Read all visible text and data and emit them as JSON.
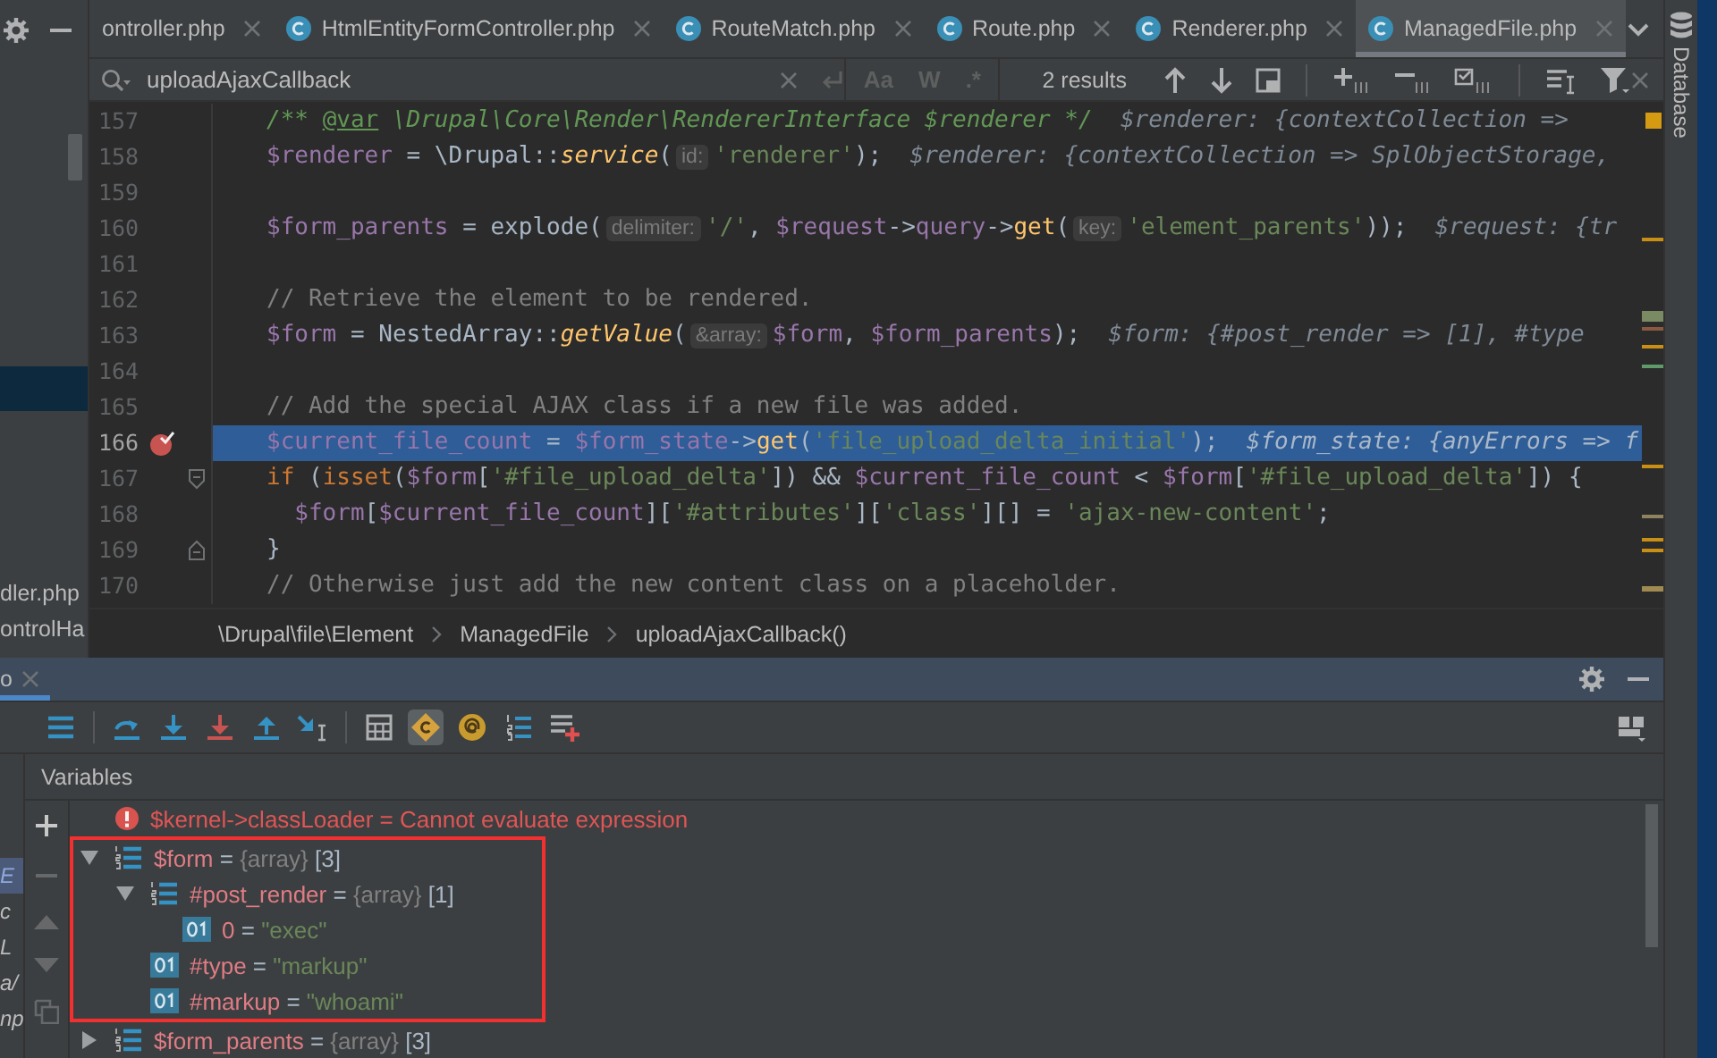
{
  "project_panel": {
    "items": [
      {
        "selected": true
      },
      {
        "label": "dler.php",
        "selected": false
      },
      {
        "label": "ontrolHa",
        "selected": false
      }
    ]
  },
  "tabs": [
    {
      "label": "ontroller.php",
      "icon": false,
      "selected": false
    },
    {
      "label": "HtmlEntityFormController.php",
      "icon": true,
      "selected": false
    },
    {
      "label": "RouteMatch.php",
      "icon": true,
      "selected": false
    },
    {
      "label": "Route.php",
      "icon": true,
      "selected": false
    },
    {
      "label": "Renderer.php",
      "icon": true,
      "selected": false
    },
    {
      "label": "ManagedFile.php",
      "icon": true,
      "selected": true
    }
  ],
  "search": {
    "value": "uploadAjaxCallback",
    "options": [
      {
        "label": "Aa",
        "on": false
      },
      {
        "label": "W",
        "on": false
      },
      {
        "label": ".*",
        "on": false
      }
    ],
    "results": "2 results"
  },
  "code_lines": [
    {
      "number": "157",
      "tokens": [
        {
          "kind": "doc",
          "text": "/** "
        },
        {
          "kind": "doctag",
          "text": "@var"
        },
        {
          "kind": "doc",
          "text": " \\Drupal\\Core\\Render\\RendererInterface $renderer */  "
        },
        {
          "kind": "val",
          "text": "$renderer: {contextCollection =>"
        }
      ]
    },
    {
      "number": "158",
      "tokens": [
        {
          "kind": "var",
          "text": "$renderer"
        },
        {
          "kind": "pl",
          "text": " = \\Drupal::"
        },
        {
          "kind": "fn",
          "text": "service"
        },
        {
          "kind": "pl",
          "text": "("
        },
        {
          "kind": "hint",
          "text": "id:"
        },
        {
          "kind": "str",
          "text": "'renderer'"
        },
        {
          "kind": "pl",
          "text": ");  "
        },
        {
          "kind": "val",
          "text": "$renderer: {contextCollection => SplObjectStorage,"
        }
      ]
    },
    {
      "number": "159"
    },
    {
      "number": "160",
      "tokens": [
        {
          "kind": "var",
          "text": "$form_parents"
        },
        {
          "kind": "pl",
          "text": " = explode("
        },
        {
          "kind": "hint",
          "text": "delimiter:"
        },
        {
          "kind": "str",
          "text": "'/'"
        },
        {
          "kind": "pl",
          "text": ", "
        },
        {
          "kind": "var",
          "text": "$request"
        },
        {
          "kind": "pl",
          "text": "->"
        },
        {
          "kind": "var",
          "text": "query"
        },
        {
          "kind": "pl",
          "text": "->"
        },
        {
          "kind": "call",
          "text": "get"
        },
        {
          "kind": "pl",
          "text": "("
        },
        {
          "kind": "hint",
          "text": "key:"
        },
        {
          "kind": "str",
          "text": "'element_parents'"
        },
        {
          "kind": "pl",
          "text": "));  "
        },
        {
          "kind": "val",
          "text": "$request: {tr"
        }
      ]
    },
    {
      "number": "161"
    },
    {
      "number": "162",
      "tokens": [
        {
          "kind": "cm",
          "text": "// Retrieve the element to be rendered."
        }
      ]
    },
    {
      "number": "163",
      "tokens": [
        {
          "kind": "var",
          "text": "$form"
        },
        {
          "kind": "pl",
          "text": " = NestedArray::"
        },
        {
          "kind": "fn",
          "text": "getValue"
        },
        {
          "kind": "pl",
          "text": "("
        },
        {
          "kind": "hint",
          "text": "&array:"
        },
        {
          "kind": "var",
          "text": "$form"
        },
        {
          "kind": "pl",
          "text": ", "
        },
        {
          "kind": "var",
          "text": "$form_parents"
        },
        {
          "kind": "pl",
          "text": ");  "
        },
        {
          "kind": "val",
          "text": "$form: {#post_render => [1], #type"
        }
      ]
    },
    {
      "number": "164"
    },
    {
      "number": "165",
      "tokens": [
        {
          "kind": "cm",
          "text": "// Add the special AJAX class if a new file was added."
        }
      ]
    },
    {
      "number": "166",
      "breakpoint": true,
      "current": true,
      "tokens": [
        {
          "kind": "var",
          "text": "$current_file_count"
        },
        {
          "kind": "pl",
          "text": " = "
        },
        {
          "kind": "var",
          "text": "$form_state"
        },
        {
          "kind": "pl",
          "text": "->"
        },
        {
          "kind": "call",
          "text": "get"
        },
        {
          "kind": "pl",
          "text": "("
        },
        {
          "kind": "str",
          "text": "'file_upload_delta_initial'"
        },
        {
          "kind": "pl",
          "text": ");  "
        },
        {
          "kind": "val",
          "text": "$form_state: {anyErrors => f"
        }
      ]
    },
    {
      "number": "167",
      "fold_start": true,
      "tokens": [
        {
          "kind": "kw",
          "text": "if"
        },
        {
          "kind": "pl",
          "text": " ("
        },
        {
          "kind": "kw",
          "text": "isset"
        },
        {
          "kind": "pl",
          "text": "("
        },
        {
          "kind": "var",
          "text": "$form"
        },
        {
          "kind": "pl",
          "text": "["
        },
        {
          "kind": "str",
          "text": "'#file_upload_delta'"
        },
        {
          "kind": "pl",
          "text": "]) && "
        },
        {
          "kind": "var",
          "text": "$current_file_count"
        },
        {
          "kind": "pl",
          "text": " < "
        },
        {
          "kind": "var",
          "text": "$form"
        },
        {
          "kind": "pl",
          "text": "["
        },
        {
          "kind": "str",
          "text": "'#file_upload_delta'"
        },
        {
          "kind": "pl",
          "text": "]) {"
        }
      ]
    },
    {
      "number": "168",
      "indented": true,
      "tokens": [
        {
          "kind": "var",
          "text": "$form"
        },
        {
          "kind": "pl",
          "text": "["
        },
        {
          "kind": "var",
          "text": "$current_file_count"
        },
        {
          "kind": "pl",
          "text": "]["
        },
        {
          "kind": "str",
          "text": "'#attributes'"
        },
        {
          "kind": "pl",
          "text": "]["
        },
        {
          "kind": "str",
          "text": "'class'"
        },
        {
          "kind": "pl",
          "text": "][] = "
        },
        {
          "kind": "str",
          "text": "'ajax-new-content'"
        },
        {
          "kind": "pl",
          "text": ";"
        }
      ]
    },
    {
      "number": "169",
      "fold_end": true,
      "tokens": [
        {
          "kind": "pl",
          "text": "}"
        }
      ]
    },
    {
      "number": "170",
      "tokens": [
        {
          "kind": "cm",
          "text": "// Otherwise just add the new content class on a placeholder."
        }
      ]
    }
  ],
  "breadcrumb": [
    "\\Drupal\\file\\Element",
    "ManagedFile",
    "uploadAjaxCallback()"
  ],
  "debug_panel": {
    "tab": "o",
    "toolbar": [
      [
        {
          "kind": "frames",
          "on": false
        }
      ],
      [
        {
          "kind": "step-over",
          "on": false
        },
        {
          "kind": "step-into",
          "on": false
        },
        {
          "kind": "force-step-into",
          "on": false
        },
        {
          "kind": "step-out",
          "on": false
        },
        {
          "kind": "run-to-cursor",
          "on": false
        }
      ],
      [
        {
          "kind": "evaluate",
          "on": false
        },
        {
          "kind": "constants",
          "on": true
        },
        {
          "kind": "globals",
          "on": false
        },
        {
          "kind": "numbered-list",
          "on": false
        },
        {
          "kind": "add-watch",
          "on": false
        }
      ]
    ],
    "frames": [
      {
        "label": "E",
        "selected": true
      },
      {
        "label": "c",
        "selected": false
      },
      {
        "label": "L",
        "selected": false
      },
      {
        "label": "a/",
        "selected": false
      },
      {
        "label": "np",
        "selected": false
      }
    ],
    "variables_title": "Variables",
    "variables_toolbar": [
      {
        "kind": "add",
        "disabled": false
      },
      {
        "kind": "remove",
        "disabled": true
      },
      {
        "kind": "up",
        "disabled": true
      },
      {
        "kind": "down",
        "disabled": true
      },
      {
        "kind": "copy",
        "disabled": true
      }
    ],
    "variables": [
      {
        "kind": "error",
        "name": "$kernel->classLoader",
        "eq": "=",
        "value": "Cannot evaluate expression"
      },
      {
        "kind": "array",
        "name": "$form",
        "eq": "=",
        "type": "{array}",
        "count": "[3]",
        "expanded": true,
        "boxed": true,
        "children": [
          {
            "kind": "array",
            "name": "#post_render",
            "eq": "=",
            "type": "{array}",
            "count": "[1]",
            "expanded": true,
            "children": [
              {
                "kind": "string",
                "name": "0",
                "eq": "=",
                "value": "\"exec\""
              }
            ]
          },
          {
            "kind": "string",
            "name": "#type",
            "eq": "=",
            "value": "\"markup\""
          },
          {
            "kind": "string",
            "name": "#markup",
            "eq": "=",
            "value": "\"whoami\""
          }
        ]
      },
      {
        "kind": "array",
        "name": "$form_parents",
        "eq": "=",
        "type": "{array}",
        "count": "[3]",
        "expanded": false
      }
    ]
  },
  "side_strip": {
    "label": "Database"
  }
}
